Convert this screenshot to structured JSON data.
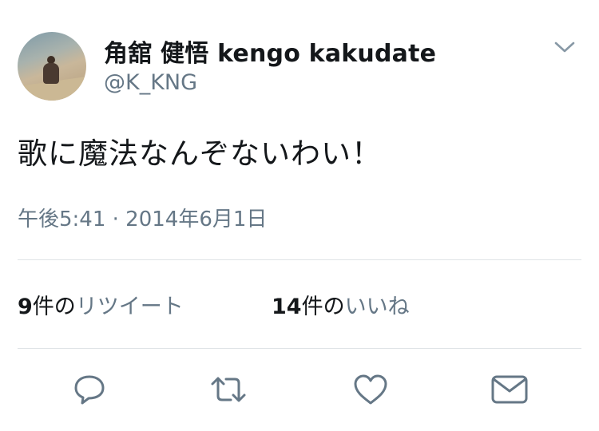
{
  "tweet": {
    "display_name": "角舘 健悟 kengo kakudate",
    "handle": "@K_KNG",
    "text": "歌に魔法なんぞないわい！",
    "timestamp": "午後5:41 · 2014年6月1日"
  },
  "stats": {
    "retweets": {
      "count": "9",
      "unit": "件の",
      "label": "リツイート"
    },
    "likes": {
      "count": "14",
      "unit": "件の",
      "label": "いいね"
    }
  },
  "actions": {
    "reply_icon": "reply-bubble-icon",
    "retweet_icon": "retweet-arrows-icon",
    "like_icon": "heart-icon",
    "dm_icon": "envelope-icon"
  },
  "colors": {
    "text_primary": "#14171a",
    "text_secondary": "#657786",
    "divider": "#dfe3e6",
    "icon": "#657786"
  }
}
